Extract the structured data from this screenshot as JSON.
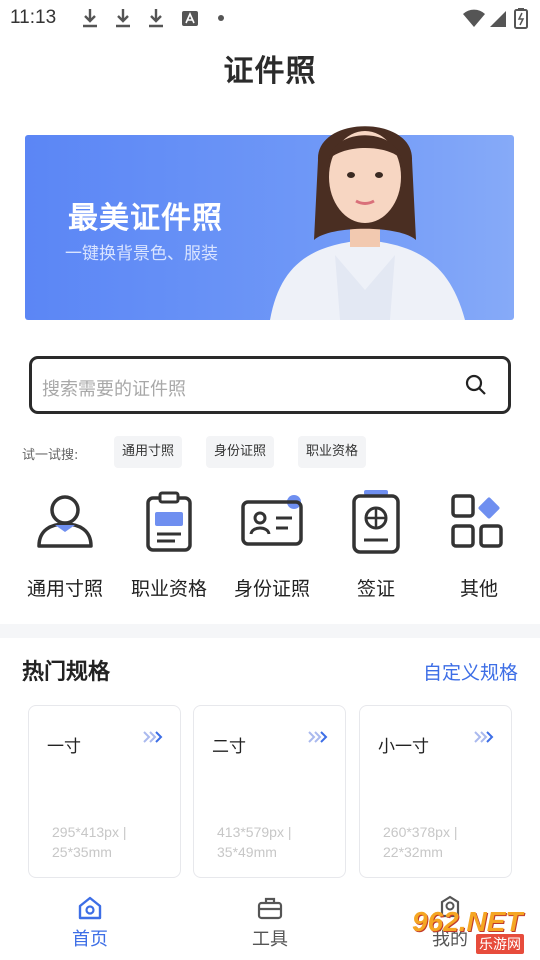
{
  "status_bar": {
    "time": "11:13"
  },
  "app": {
    "title": "证件照"
  },
  "banner": {
    "title": "最美证件照",
    "subtitle": "一键换背景色、服装"
  },
  "search": {
    "placeholder": "搜索需要的证件照"
  },
  "try_search": {
    "label": "试一试搜:",
    "chips": [
      "通用寸照",
      "身份证照",
      "职业资格"
    ]
  },
  "categories": [
    {
      "label": "通用寸照",
      "icon": "person-icon"
    },
    {
      "label": "职业资格",
      "icon": "clipboard-icon"
    },
    {
      "label": "身份证照",
      "icon": "id-card-icon"
    },
    {
      "label": "签证",
      "icon": "passport-icon"
    },
    {
      "label": "其他",
      "icon": "grid-icon"
    }
  ],
  "hot": {
    "title": "热门规格",
    "custom_link": "自定义规格",
    "cards": [
      {
        "name": "一寸",
        "spec": "295*413px | 25*35mm"
      },
      {
        "name": "二寸",
        "spec": "413*579px | 35*49mm"
      },
      {
        "name": "小一寸",
        "spec": "260*378px | 22*32mm"
      }
    ]
  },
  "tabs": [
    {
      "label": "首页",
      "icon": "home-icon",
      "active": true
    },
    {
      "label": "工具",
      "icon": "briefcase-icon",
      "active": false
    },
    {
      "label": "我的",
      "icon": "user-icon",
      "active": false
    }
  ],
  "watermark": {
    "logo": "962.NET",
    "text": "乐游网"
  },
  "colors": {
    "accent": "#3d6ee6",
    "banner": "#5b86f5",
    "text": "#222222"
  }
}
